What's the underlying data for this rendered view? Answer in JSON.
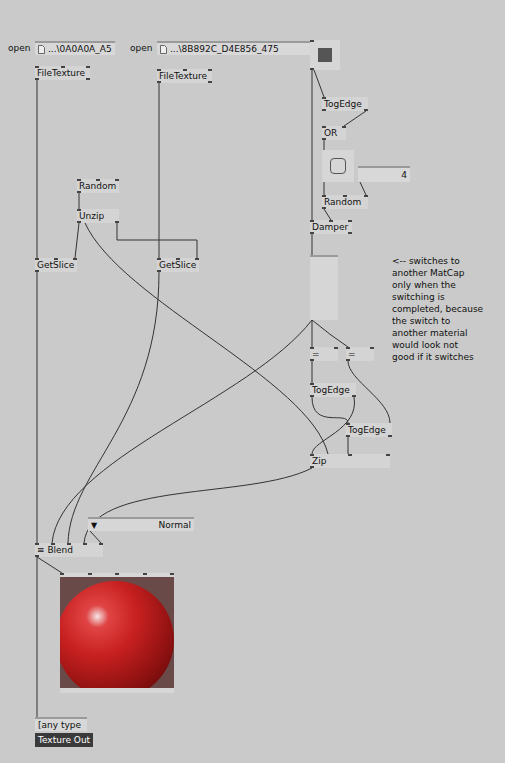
{
  "file_paths": [
    {
      "button": "open",
      "path": "...\\0A0A0A_A5"
    },
    {
      "button": "open",
      "path": "...\\8B892C_D4E856_475"
    }
  ],
  "nodes": [
    {
      "label": "FileTexture"
    },
    {
      "label": "FileTexture"
    },
    {
      "label": "Random"
    },
    {
      "label": "Unzip"
    },
    {
      "label": "GetSlice"
    },
    {
      "label": "GetSlice"
    },
    {
      "label": "TogEdge"
    },
    {
      "label": "OR"
    },
    {
      "label": "Random"
    },
    {
      "label": "Damper"
    },
    {
      "label": "="
    },
    {
      "label": "="
    },
    {
      "label": "TogEdge"
    },
    {
      "label": "TogEdge"
    },
    {
      "label": "Zip"
    }
  ],
  "toggle": {
    "on": true
  },
  "bang": {
    "on": false
  },
  "number_box": {
    "value": "4"
  },
  "slider": {
    "level": 0
  },
  "comment_lines": [
    "<-- switches to",
    "another MatCap",
    "only when the",
    "switching is",
    "completed, because",
    "the switch to",
    "another material",
    "would look not",
    "good if it switches"
  ],
  "enum": {
    "icon": "▼",
    "value": "Normal"
  },
  "blend": {
    "icon": "≡",
    "label": "Blend"
  },
  "output": {
    "value": "[any type",
    "label": "Texture Out"
  }
}
